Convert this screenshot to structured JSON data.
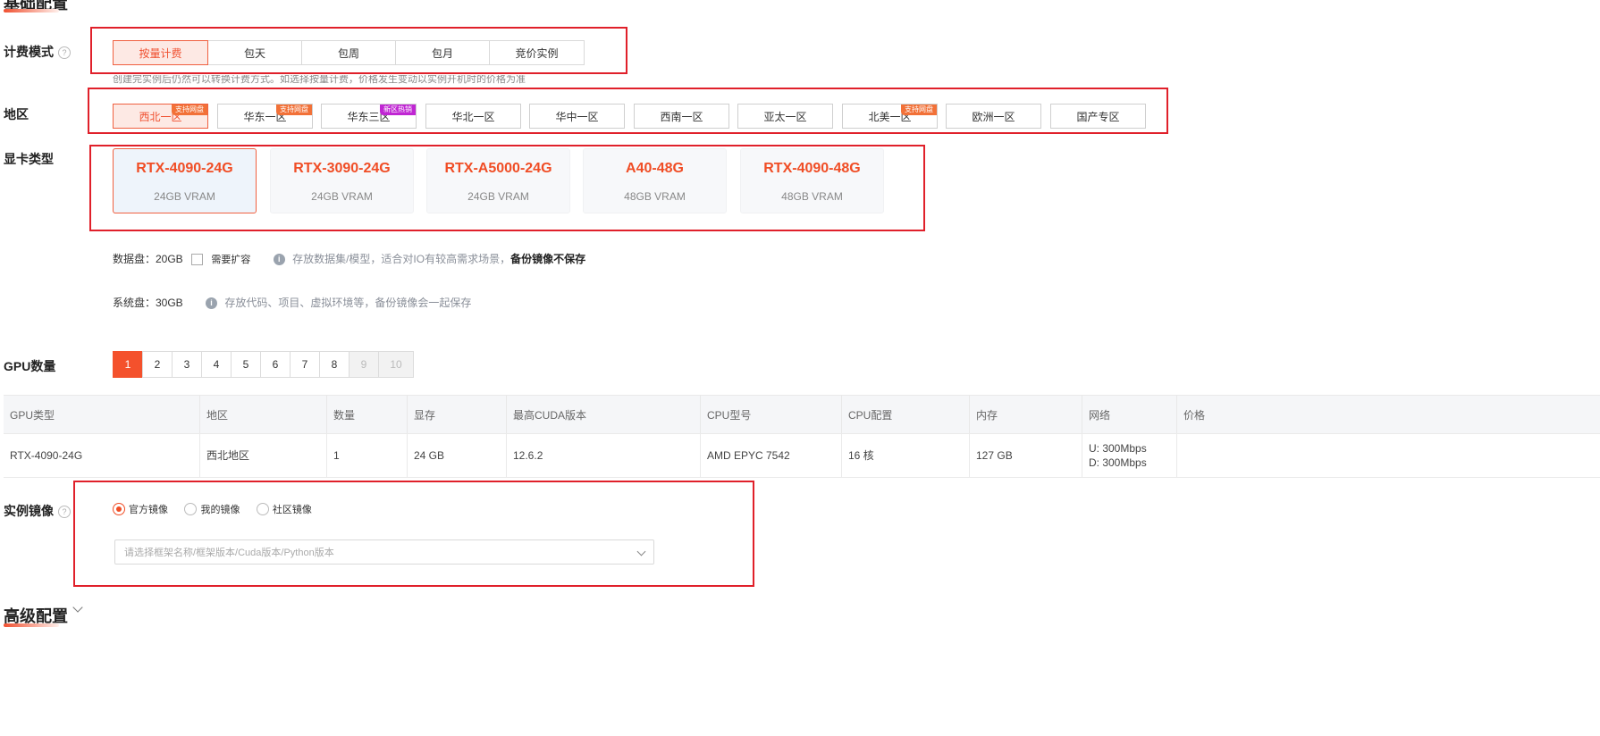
{
  "basic_config": {
    "title": "基础配置"
  },
  "billing": {
    "label": "计费模式",
    "help": "?",
    "options": [
      "按量计费",
      "包天",
      "包周",
      "包月",
      "竞价实例"
    ],
    "hint": "创建完实例后仍然可以转换计费方式。如选择按量计费，价格发生变动以实例开机时的价格为准"
  },
  "region": {
    "label": "地区",
    "options": [
      {
        "name": "西北一区",
        "tag": "支持网盘"
      },
      {
        "name": "华东一区",
        "tag": "支持网盘"
      },
      {
        "name": "华东三区",
        "tag": "新区热销"
      },
      {
        "name": "华北一区",
        "tag": ""
      },
      {
        "name": "华中一区",
        "tag": ""
      },
      {
        "name": "西南一区",
        "tag": ""
      },
      {
        "name": "亚太一区",
        "tag": ""
      },
      {
        "name": "北美一区",
        "tag": "支持网盘"
      },
      {
        "name": "欧洲一区",
        "tag": ""
      },
      {
        "name": "国产专区",
        "tag": ""
      }
    ]
  },
  "gpu_type": {
    "label": "显卡类型",
    "cards": [
      {
        "name": "RTX-4090-24G",
        "vram": "24GB VRAM"
      },
      {
        "name": "RTX-3090-24G",
        "vram": "24GB VRAM"
      },
      {
        "name": "RTX-A5000-24G",
        "vram": "24GB VRAM"
      },
      {
        "name": "A40-48G",
        "vram": "48GB VRAM"
      },
      {
        "name": "RTX-4090-48G",
        "vram": "48GB VRAM"
      }
    ]
  },
  "data_disk": {
    "label": "数据盘：20GB",
    "expand": "需要扩容",
    "info_icon": "i",
    "desc": "存放数据集/模型，适合对IO有较高需求场景，",
    "desc_bold": "备份镜像不保存"
  },
  "system_disk": {
    "label": "系统盘：30GB",
    "info_icon": "i",
    "desc": "存放代码、项目、虚拟环境等，备份镜像会一起保存"
  },
  "gpu_count": {
    "label": "GPU数量",
    "options": [
      "1",
      "2",
      "3",
      "4",
      "5",
      "6",
      "7",
      "8",
      "9",
      "10"
    ]
  },
  "spec_table": {
    "headers": [
      "GPU类型",
      "地区",
      "数量",
      "显存",
      "最高CUDA版本",
      "CPU型号",
      "CPU配置",
      "内存",
      "网络",
      "价格"
    ],
    "row": [
      "RTX-4090-24G",
      "西北地区",
      "1",
      "24 GB",
      "12.6.2",
      "AMD EPYC 7542",
      "16 核",
      "127 GB"
    ],
    "network_up": "U: 300Mbps",
    "network_down": "D: 300Mbps",
    "price": ""
  },
  "image": {
    "label": "实例镜像",
    "help": "?",
    "radios": [
      "官方镜像",
      "我的镜像",
      "社区镜像"
    ],
    "placeholder": "请选择框架名称/框架版本/Cuda版本/Python版本"
  },
  "advanced": {
    "title": "高级配置"
  },
  "colors": {
    "accent": "#f04d25",
    "highlight_box": "#e0202a"
  }
}
